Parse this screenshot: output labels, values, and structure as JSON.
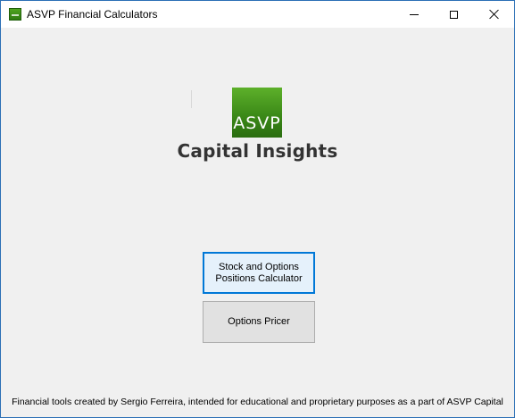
{
  "window": {
    "title": "ASVP Financial Calculators",
    "controls": {
      "minimize": "minimize-icon",
      "maximize": "maximize-icon",
      "close": "close-icon"
    }
  },
  "logo": {
    "text": "ASVP",
    "color": "#3c8a18"
  },
  "brand": {
    "name": "Capital Insights"
  },
  "buttons": {
    "stock_options": "Stock and Options\nPositions Calculator",
    "options_pricer": "Options Pricer"
  },
  "footer": {
    "text": "Financial tools created by Sergio Ferreira, intended for educational and proprietary purposes as a part of ASVP Capital"
  },
  "colors": {
    "focus_border": "#0078d7",
    "window_border": "#2b6fb6"
  }
}
